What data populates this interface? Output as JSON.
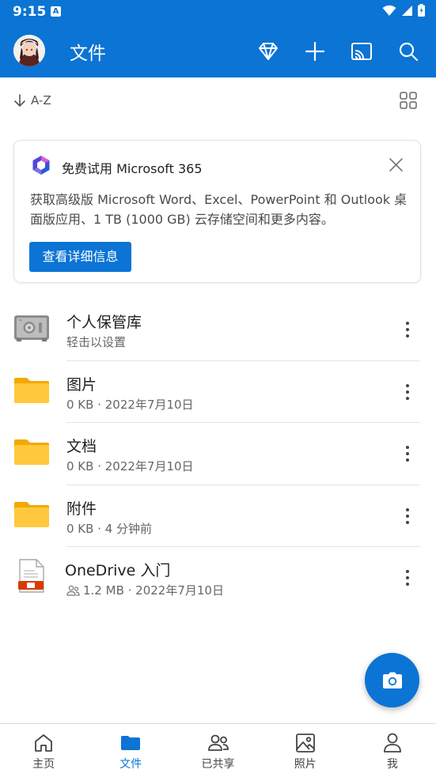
{
  "status_bar": {
    "time": "9:15",
    "notif_letter": "A"
  },
  "app_bar": {
    "title": "文件",
    "actions": [
      "premium-diamond-icon",
      "add-icon",
      "cast-icon",
      "search-icon"
    ]
  },
  "sort": {
    "label": "A-Z"
  },
  "promo": {
    "title": "免费试用 Microsoft 365",
    "description": "获取高级版 Microsoft Word、Excel、PowerPoint 和 Outlook 桌面版应用、1 TB (1000 GB) 云存储空间和更多内容。",
    "button_label": "查看详细信息"
  },
  "files": [
    {
      "name": "个人保管库",
      "meta": "轻击以设置",
      "icon": "vault-icon"
    },
    {
      "name": "图片",
      "meta": "0 KB · 2022年7月10日",
      "icon": "folder-icon"
    },
    {
      "name": "文档",
      "meta": "0 KB · 2022年7月10日",
      "icon": "folder-icon"
    },
    {
      "name": "附件",
      "meta": "0 KB · 4 分钟前",
      "icon": "folder-icon"
    },
    {
      "name": "OneDrive 入门",
      "meta": "1.2 MB · 2022年7月10日",
      "icon": "pdf-file-icon",
      "shared": true
    }
  ],
  "bottom_nav": [
    {
      "label": "主页",
      "icon": "home-icon"
    },
    {
      "label": "文件",
      "icon": "files-folder-icon",
      "active": true
    },
    {
      "label": "已共享",
      "icon": "shared-people-icon"
    },
    {
      "label": "照片",
      "icon": "photo-icon"
    },
    {
      "label": "我",
      "icon": "me-person-icon"
    }
  ],
  "colors": {
    "brand": "#0b74d4",
    "folder": "#ffc83d",
    "text_secondary": "#666666"
  }
}
